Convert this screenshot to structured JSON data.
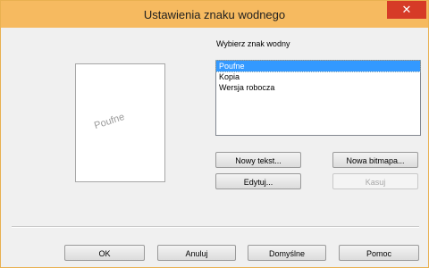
{
  "window": {
    "title": "Ustawienia znaku wodnego",
    "close_symbol": "✕"
  },
  "preview": {
    "watermark_text": "Poufne"
  },
  "watermark_list": {
    "label": "Wybierz znak wodny",
    "items": [
      "Poufne",
      "Kopia",
      "Wersja robocza"
    ],
    "selected": "Poufne"
  },
  "actions": {
    "new_text": "Nowy tekst...",
    "new_bitmap": "Nowa bitmapa...",
    "edit": "Edytuj...",
    "delete": "Kasuj"
  },
  "footer": {
    "ok": "OK",
    "cancel": "Anuluj",
    "defaults": "Domyślne",
    "help": "Pomoc"
  },
  "colors": {
    "titlebar": "#f6ba60",
    "close_button": "#d63b27",
    "selection": "#3399ff"
  },
  "icons": {
    "close": "close-icon"
  }
}
